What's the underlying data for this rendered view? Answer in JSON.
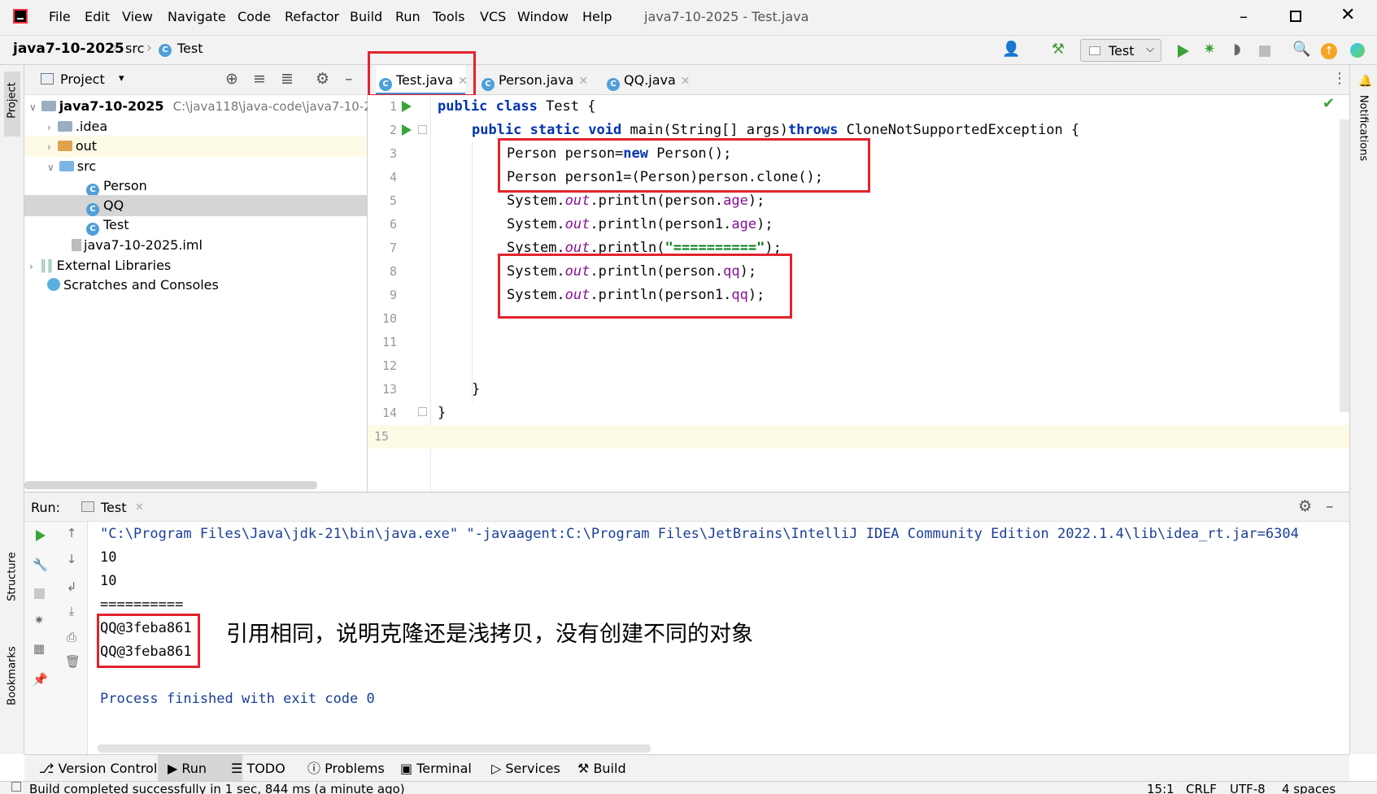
{
  "menubar": {
    "items": [
      "File",
      "Edit",
      "View",
      "Navigate",
      "Code",
      "Refactor",
      "Build",
      "Run",
      "Tools",
      "VCS",
      "Window",
      "Help"
    ],
    "window_title": "java7-10-2025 - Test.java"
  },
  "breadcrumb": {
    "project": "java7-10-2025",
    "folder": "src",
    "file": "Test"
  },
  "toolbar": {
    "run_config": "Test"
  },
  "project_panel": {
    "title": "Project",
    "root_name": "java7-10-2025",
    "root_path": "C:\\java118\\java-code\\java7-10-2",
    "items": [
      ".idea",
      "out",
      "src",
      "Person",
      "QQ",
      "Test",
      "java7-10-2025.iml",
      "External Libraries",
      "Scratches and Consoles"
    ]
  },
  "side_labels": {
    "project": "Project",
    "structure": "Structure",
    "bookmarks": "Bookmarks",
    "notifications": "Notifications"
  },
  "editor": {
    "tabs": [
      "Test.java",
      "Person.java",
      "QQ.java"
    ],
    "line_numbers": [
      "1",
      "2",
      "3",
      "4",
      "5",
      "6",
      "7",
      "8",
      "9",
      "10",
      "11",
      "12",
      "13",
      "14",
      "15"
    ],
    "code": {
      "l1_kw": "public class",
      "l1_rest": " Test {",
      "l2_kw1": "public static void",
      "l2_mid": " main(String[] args)",
      "l2_kw2": "throws",
      "l2_rest": " CloneNotSupportedException {",
      "l3_a": "Person person=",
      "l3_kw": "new",
      "l3_b": " Person();",
      "l4": "Person person1=(Person)person.clone();",
      "sys": "System.",
      "out": "out",
      "println_person": ".println(person.",
      "println_person1": ".println(person1.",
      "println_open": ".println(",
      "age": "age",
      "qq": "qq",
      "close": ");",
      "equals_str": "\"==========\"",
      "brace_inner": "}",
      "brace_outer": "}"
    }
  },
  "run_panel": {
    "label": "Run:",
    "tab": "Test",
    "output": [
      "\"C:\\Program Files\\Java\\jdk-21\\bin\\java.exe\" \"-javaagent:C:\\Program Files\\JetBrains\\IntelliJ IDEA Community Edition 2022.1.4\\lib\\idea_rt.jar=6304",
      "10",
      "10",
      "==========",
      "QQ@3feba861",
      "QQ@3feba861",
      "",
      "Process finished with exit code 0"
    ],
    "annotation": "引用相同，说明克隆还是浅拷贝，没有创建不同的对象"
  },
  "bottom_tabs": [
    "Version Control",
    "Run",
    "TODO",
    "Problems",
    "Terminal",
    "Services",
    "Build"
  ],
  "status": {
    "message": "Build completed successfully in 1 sec, 844 ms (a minute ago)",
    "position": "15:1",
    "line_sep": "CRLF",
    "encoding": "UTF-8",
    "indent": "4 spaces"
  },
  "colors": {
    "highlight_box": "#e3232d",
    "keyword": "#0033b3",
    "field": "#871094",
    "string": "#067d17",
    "console_blue": "#1a3e9a"
  }
}
